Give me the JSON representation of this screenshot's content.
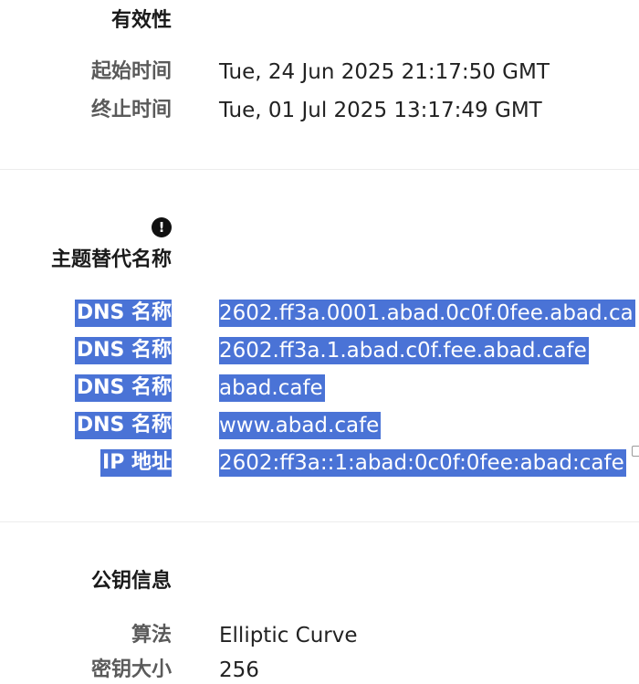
{
  "validity": {
    "title": "有效性",
    "rows": [
      {
        "label": "起始时间",
        "value": "Tue, 24 Jun 2025 21:17:50 GMT"
      },
      {
        "label": "终止时间",
        "value": "Tue, 01 Jul 2025 13:17:49 GMT"
      }
    ]
  },
  "san": {
    "title": "主题替代名称",
    "alert_icon": "exclamation-circle-icon",
    "rows": [
      {
        "label": "DNS 名称",
        "value": "2602.ff3a.0001.abad.0c0f.0fee.abad.ca"
      },
      {
        "label": "DNS 名称",
        "value": "2602.ff3a.1.abad.c0f.fee.abad.cafe"
      },
      {
        "label": "DNS 名称",
        "value": "abad.cafe"
      },
      {
        "label": "DNS 名称",
        "value": "www.abad.cafe"
      },
      {
        "label": "IP 地址",
        "value": "2602:ff3a::1:abad:0c0f:0fee:abad:cafe"
      }
    ]
  },
  "public_key": {
    "title": "公钥信息",
    "rows": [
      {
        "label": "算法",
        "value": "Elliptic Curve"
      },
      {
        "label": "密钥大小",
        "value": "256"
      }
    ]
  },
  "colors": {
    "selection": "#4a73d6",
    "label_gray": "#5a5a5a",
    "divider": "#ececec"
  }
}
